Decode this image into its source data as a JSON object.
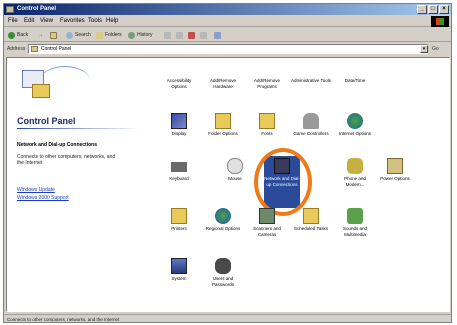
{
  "window": {
    "title": "Control Panel",
    "controls": [
      "_",
      "□",
      "×"
    ]
  },
  "menubar": [
    "File",
    "Edit",
    "View",
    "Favorites",
    "Tools",
    "Help"
  ],
  "toolbar": {
    "back": "Back",
    "forward": "→",
    "up": "↑",
    "search": "Search",
    "folders": "Folders",
    "history": "History"
  },
  "address": {
    "label": "Address",
    "value": "Control Panel",
    "go": "Go"
  },
  "left_pane": {
    "title": "Control Panel",
    "selected_title": "Network and Dial-up Connections",
    "selected_desc": "Connects to other computers, networks, and the Internet",
    "link_windows_update": "Windows Update",
    "link_support": "Windows 2000 Support"
  },
  "icons": {
    "accessibility": "Accessibility Options",
    "add_hardware": "Add/Remove Hardware",
    "add_programs": "Add/Remove Programs",
    "admin_tools": "Administrative Tools",
    "date_time": "Date/Time",
    "display": "Display",
    "folder_options": "Folder Options",
    "fonts": "Fonts",
    "game_controllers": "Game Controllers",
    "internet_options": "Internet Options",
    "keyboard": "Keyboard",
    "mouse": "Mouse",
    "network": "Network and Dial-up Connections",
    "phone_modem": "Phone and Modem...",
    "power_options": "Power Options",
    "printers": "Printers",
    "regional": "Regional Options",
    "scanners": "Scanners and Cameras",
    "scheduled_tasks": "Scheduled Tasks",
    "sounds": "Sounds and Multimedia",
    "system": "System",
    "users_passwords": "Users and Passwords"
  },
  "statusbar": {
    "text": "Connects to other computers, networks, and the Internet"
  },
  "colors": {
    "title_start": "#0a246a",
    "title_end": "#a6caf0",
    "highlight_circle": "#ef7a1a",
    "selection": "#2a4a9a"
  }
}
